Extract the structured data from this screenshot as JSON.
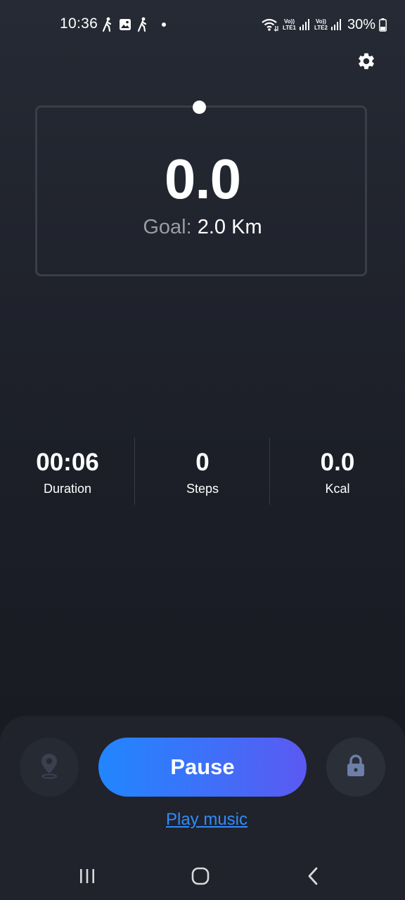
{
  "status_bar": {
    "time": "10:36",
    "battery_percent": "30%",
    "sim1_label_top": "Vo))",
    "sim1_label_bottom": "LTE1",
    "sim2_label_top": "Vo))",
    "sim2_label_bottom": "LTE2",
    "icons": [
      "walking-icon",
      "gallery-icon",
      "walking-icon",
      "dot-icon",
      "wifi-icon",
      "signal-icon",
      "signal-icon",
      "battery-icon"
    ]
  },
  "header": {
    "settings_icon": "gear-icon"
  },
  "distance": {
    "value": "0.0",
    "goal_label": "Goal:",
    "goal_value": "2.0 Km",
    "progress_fraction": 0.0
  },
  "stats": [
    {
      "value": "00:06",
      "label": "Duration"
    },
    {
      "value": "0",
      "label": "Steps"
    },
    {
      "value": "0.0",
      "label": "Kcal"
    }
  ],
  "controls": {
    "location_icon": "location-pin-icon",
    "pause_label": "Pause",
    "lock_icon": "lock-icon",
    "play_music_label": "Play music"
  },
  "nav_bar": {
    "icons": [
      "recent-apps-icon",
      "home-icon",
      "back-icon"
    ]
  },
  "colors": {
    "background_top": "#262a34",
    "background_bottom": "#16181f",
    "accent_blue": "#2186ff",
    "accent_purple": "#5b59f2",
    "link_blue": "#2f8cff",
    "muted_text": "#9a9ca3"
  }
}
